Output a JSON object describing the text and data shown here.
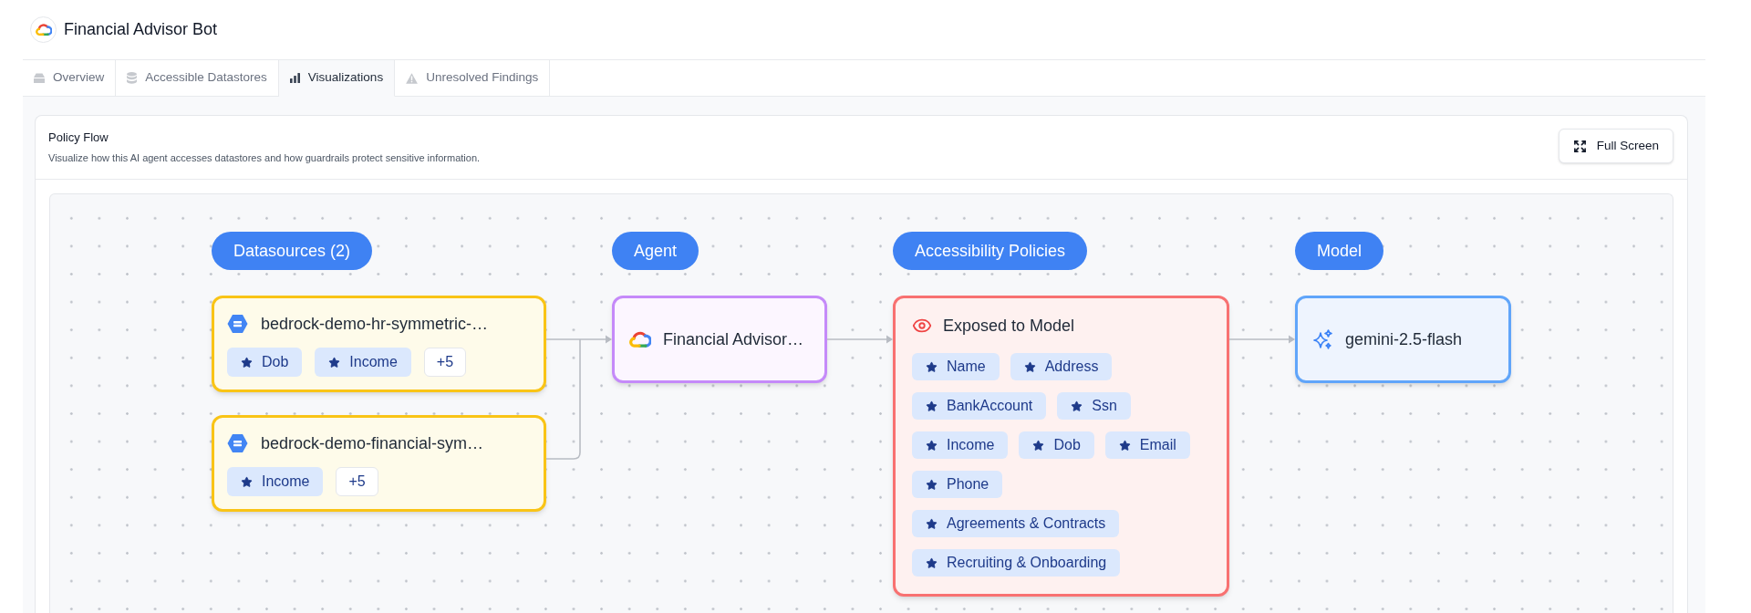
{
  "app": {
    "title": "Financial Advisor Bot"
  },
  "tabs": [
    {
      "label": "Overview",
      "selected": false
    },
    {
      "label": "Accessible Datastores",
      "selected": false
    },
    {
      "label": "Visualizations",
      "selected": true
    },
    {
      "label": "Unresolved Findings",
      "selected": false
    }
  ],
  "panel": {
    "title": "Policy Flow",
    "description": "Visualize how this AI agent accesses datastores and how guardrails protect sensitive information.",
    "button": "Full Screen"
  },
  "flow": {
    "columns": [
      {
        "header": "Datasources (2)",
        "nodes": [
          {
            "kind": "datasource",
            "title": "bedrock-demo-hr-symmetric-…",
            "tags": [
              "Dob",
              "Income"
            ],
            "more": "+5"
          },
          {
            "kind": "datasource",
            "title": "bedrock-demo-financial-sym…",
            "tags": [
              "Income"
            ],
            "more": "+5"
          }
        ]
      },
      {
        "header": "Agent",
        "nodes": [
          {
            "kind": "agent",
            "title": "Financial Advisor…"
          }
        ]
      },
      {
        "header": "Accessibility Policies",
        "nodes": [
          {
            "kind": "policy",
            "title": "Exposed to Model",
            "tags": [
              "Name",
              "Address",
              "BankAccount",
              "Ssn",
              "Income",
              "Dob",
              "Email",
              "Phone",
              "Agreements & Contracts",
              "Recruiting & Onboarding"
            ]
          }
        ]
      },
      {
        "header": "Model",
        "nodes": [
          {
            "kind": "model",
            "title": "gemini-2.5-flash"
          }
        ]
      }
    ]
  }
}
